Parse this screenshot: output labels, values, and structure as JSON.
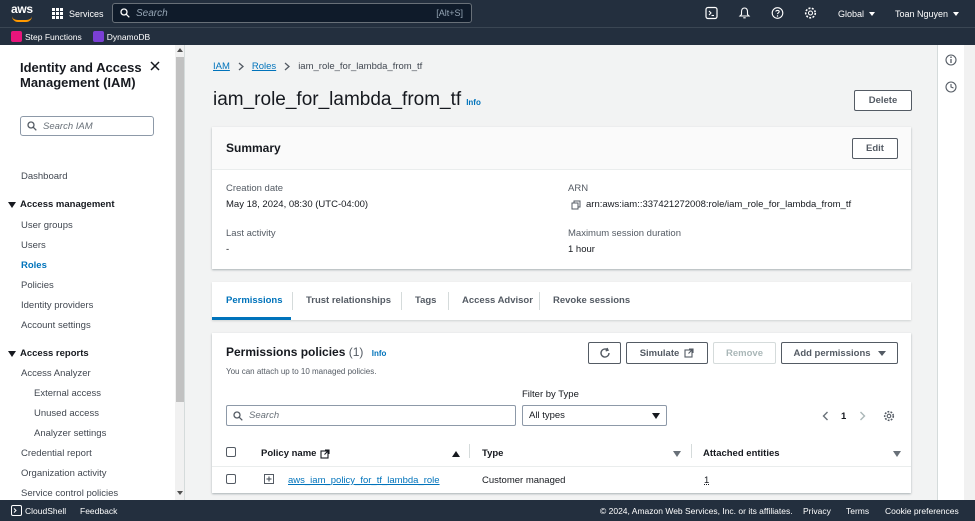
{
  "topnav": {
    "logo": "aws",
    "services_label": "Services",
    "search_placeholder": "Search",
    "search_shortcut": "[Alt+S]",
    "region_label": "Global",
    "user_label": "Toan Nguyen"
  },
  "favorites": [
    {
      "label": "Step Functions",
      "color": "#e7157b"
    },
    {
      "label": "DynamoDB",
      "color": "#7a3fd4"
    }
  ],
  "sidebar": {
    "title": "Identity and Access Management (IAM)",
    "search_placeholder": "Search IAM",
    "dashboard": "Dashboard",
    "access_management": "Access management",
    "am_items": [
      "User groups",
      "Users",
      "Roles",
      "Policies",
      "Identity providers",
      "Account settings"
    ],
    "access_reports": "Access reports",
    "access_analyzer": "Access Analyzer",
    "analyzer_items": [
      "External access",
      "Unused access",
      "Analyzer settings"
    ],
    "report_items": [
      "Credential report",
      "Organization activity",
      "Service control policies"
    ]
  },
  "breadcrumb": [
    "IAM",
    "Roles",
    "iam_role_for_lambda_from_tf"
  ],
  "page": {
    "title": "iam_role_for_lambda_from_tf",
    "info": "Info",
    "delete_label": "Delete"
  },
  "summary": {
    "title": "Summary",
    "edit_label": "Edit",
    "creation_date_label": "Creation date",
    "creation_date": "May 18, 2024, 08:30 (UTC-04:00)",
    "arn_label": "ARN",
    "arn": "arn:aws:iam::337421272008:role/iam_role_for_lambda_from_tf",
    "last_activity_label": "Last activity",
    "last_activity": "-",
    "max_session_label": "Maximum session duration",
    "max_session": "1 hour"
  },
  "tabs": [
    "Permissions",
    "Trust relationships",
    "Tags",
    "Access Advisor",
    "Revoke sessions"
  ],
  "permissions": {
    "title": "Permissions policies",
    "count": "(1)",
    "info": "Info",
    "subtitle": "You can attach up to 10 managed policies.",
    "simulate_label": "Simulate",
    "remove_label": "Remove",
    "add_label": "Add permissions",
    "filter_label": "Filter by Type",
    "search_placeholder": "Search",
    "filter_value": "All types",
    "page_number": "1",
    "columns": [
      "Policy name",
      "Type",
      "Attached entities"
    ],
    "rows": [
      {
        "name": "aws_iam_policy_for_tf_lambda_role",
        "type": "Customer managed",
        "entities": "1"
      }
    ]
  },
  "footer": {
    "cloudshell": "CloudShell",
    "feedback": "Feedback",
    "copyright": "© 2024, Amazon Web Services, Inc. or its affiliates.",
    "privacy": "Privacy",
    "terms": "Terms",
    "cookies": "Cookie preferences"
  }
}
